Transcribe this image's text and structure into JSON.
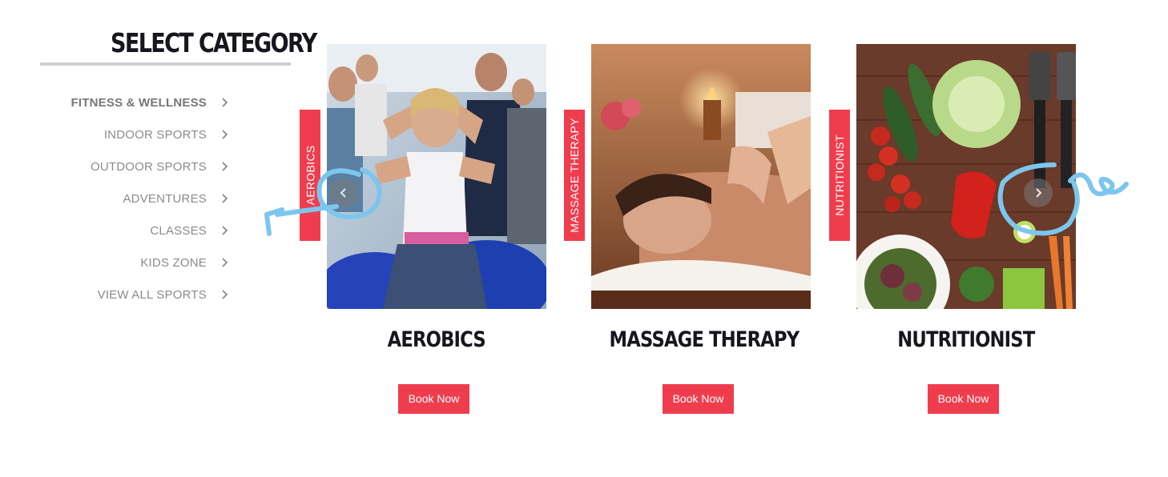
{
  "sidebar": {
    "title": "SELECT CATEGORY",
    "items": [
      {
        "label": "FITNESS & WELLNESS",
        "active": true
      },
      {
        "label": "INDOOR SPORTS"
      },
      {
        "label": "OUTDOOR SPORTS"
      },
      {
        "label": "ADVENTURES"
      },
      {
        "label": "CLASSES"
      },
      {
        "label": "KIDS ZONE"
      },
      {
        "label": "VIEW ALL SPORTS"
      }
    ]
  },
  "cards": [
    {
      "tag": "AEROBICS",
      "title": "AEROBICS",
      "button": "Book Now"
    },
    {
      "tag": "MASSAGE THERAPY",
      "title": "MASSAGE THERAPY",
      "button": "Book Now"
    },
    {
      "tag": "NUTRITIONIST",
      "title": "NUTRITIONIST",
      "button": "Book Now"
    }
  ],
  "colors": {
    "accent": "#ef3d4d",
    "heading": "#16161d",
    "muted": "#8b8b8b",
    "annotation": "#7cc6ee"
  },
  "icons": {
    "prev": "chevron-left-icon",
    "next": "chevron-right-icon",
    "list": "chevron-right-icon"
  }
}
